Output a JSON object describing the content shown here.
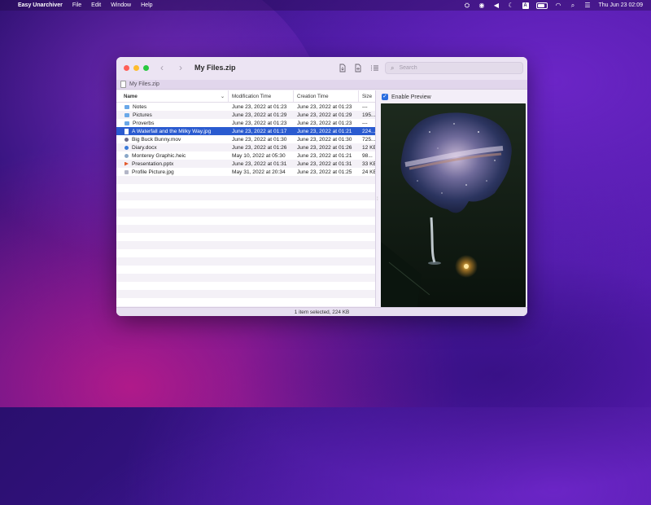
{
  "menubar": {
    "app_name": "Easy Unarchiver",
    "menus": [
      "File",
      "Edit",
      "Window",
      "Help"
    ],
    "clock": "Thu Jun 23  02:09",
    "input_letter": "A"
  },
  "window": {
    "title": "My Files.zip",
    "path": "My Files.zip",
    "search_placeholder": "Search",
    "columns": {
      "name": "Name",
      "modified": "Modification Time",
      "created": "Creation Time",
      "size": "Size"
    },
    "rows": [
      {
        "icon": "folder",
        "name": "Notes",
        "modified": "June 23, 2022 at 01:23",
        "created": "June 23, 2022 at 01:23",
        "size": "---"
      },
      {
        "icon": "folder",
        "name": "Pictures",
        "modified": "June 23, 2022 at 01:29",
        "created": "June 23, 2022 at 01:29",
        "size": "195..."
      },
      {
        "icon": "folder",
        "name": "Proverbs",
        "modified": "June 23, 2022 at 01:23",
        "created": "June 23, 2022 at 01:23",
        "size": "---"
      },
      {
        "icon": "doc",
        "name": "A Waterfall and the Milky Way.jpg",
        "modified": "June 23, 2022 at 01:17",
        "created": "June 23, 2022 at 01:21",
        "size": "224...",
        "selected": true
      },
      {
        "icon": "mov",
        "name": "Big Buck Bunny.mov",
        "modified": "June 23, 2022 at 01:30",
        "created": "June 23, 2022 at 01:30",
        "size": "725..."
      },
      {
        "icon": "docx",
        "name": "Diary.docx",
        "modified": "June 23, 2022 at 01:26",
        "created": "June 23, 2022 at 01:26",
        "size": "12 KB"
      },
      {
        "icon": "heic",
        "name": "Monterey Graphic.heic",
        "modified": "May 10, 2022 at 05:30",
        "created": "June 23, 2022 at 01:21",
        "size": "98..."
      },
      {
        "icon": "pptx",
        "name": "Presentation.pptx",
        "modified": "June 23, 2022 at 01:31",
        "created": "June 23, 2022 at 01:31",
        "size": "33 KB"
      },
      {
        "icon": "jpg2",
        "name": "Profile Picture.jpg",
        "modified": "May 31, 2022 at 20:34",
        "created": "June 23, 2022 at 01:25",
        "size": "24 KB"
      }
    ],
    "preview_label": "Enable Preview",
    "preview_enabled": true,
    "status": "1 item selected, 224 KB"
  }
}
